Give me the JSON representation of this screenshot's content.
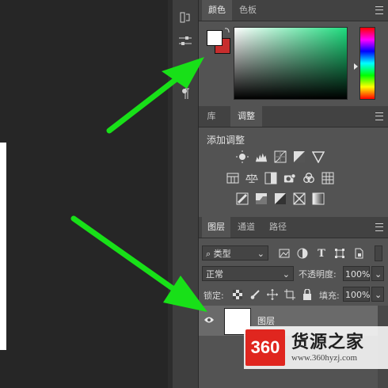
{
  "color_panel": {
    "tabs": [
      "颜色",
      "色板"
    ],
    "foreground_color": "#ffffff",
    "background_color": "#c72d2d",
    "field_hue": "#1edc7e"
  },
  "adjust_panel": {
    "tabs": [
      "库",
      "调整"
    ],
    "heading": "添加调整",
    "icons": [
      "brightness-icon",
      "levels-icon",
      "curves-icon",
      "exposure-icon",
      "vibrance-icon",
      "hue-saturation-icon",
      "color-balance-icon",
      "black-white-icon",
      "photo-filter-icon",
      "channel-mixer-icon",
      "color-lookup-icon",
      "invert-icon",
      "posterize-icon",
      "threshold-icon",
      "selective-color-icon",
      "gradient-map-icon"
    ]
  },
  "layers_panel": {
    "tabs": [
      "图层",
      "通道",
      "路径"
    ],
    "filter_kind": "类型",
    "blend_mode": "正常",
    "opacity_label": "不透明度:",
    "opacity_value": "100%",
    "lock_label": "锁定:",
    "fill_label": "填充:",
    "fill_value": "100%",
    "layer_name": "图层"
  },
  "watermark": {
    "logo": "360",
    "text": "货源之家",
    "url": "www.360hyzj.com"
  },
  "colors": {
    "arrow": "#18e018"
  }
}
